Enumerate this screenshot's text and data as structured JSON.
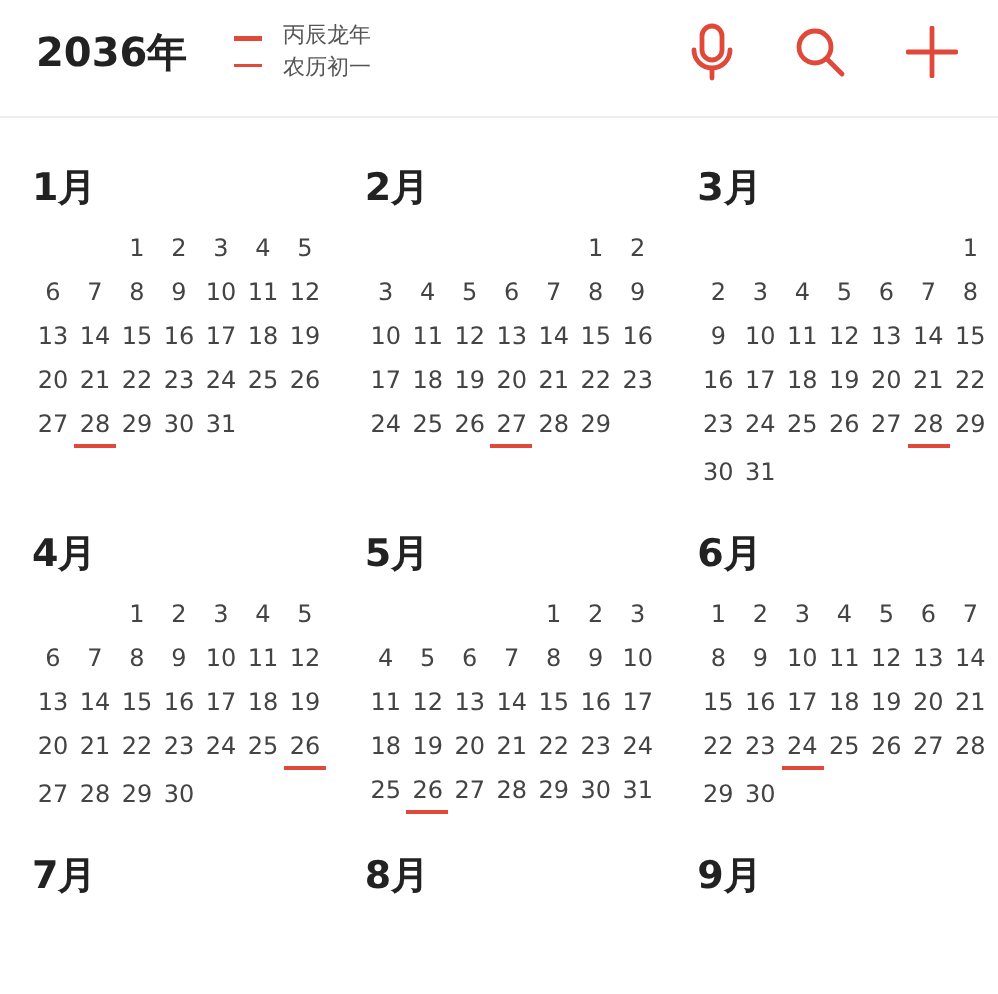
{
  "header": {
    "year": "2036年",
    "lunar_lines": [
      "丙辰龙年",
      "农历初一"
    ]
  },
  "months": [
    {
      "label": "1月",
      "weeks": [
        {
          "days": [
            {
              "day": "1",
              "underlined": false
            },
            {
              "day": "2",
              "underlined": false
            },
            {
              "day": "3",
              "underlined": false
            },
            {
              "day": "4",
              "underlined": false
            },
            {
              "day": "5",
              "underlined": false
            }
          ]
        },
        {
          "days": [
            {
              "day": "6",
              "underlined": false
            },
            {
              "day": "7",
              "underlined": false
            },
            {
              "day": "8",
              "underlined": false
            },
            {
              "day": "9",
              "underlined": false
            },
            {
              "day": "10",
              "underlined": false
            },
            {
              "day": "11",
              "underlined": false
            },
            {
              "day": "12",
              "underlined": false
            }
          ]
        },
        {
          "days": [
            {
              "day": "13",
              "underlined": false
            },
            {
              "day": "14",
              "underlined": false
            },
            {
              "day": "15",
              "underlined": false
            },
            {
              "day": "16",
              "underlined": false
            },
            {
              "day": "17",
              "underlined": false
            },
            {
              "day": "18",
              "underlined": false
            },
            {
              "day": "19",
              "underlined": false
            }
          ]
        },
        {
          "days": [
            {
              "day": "20",
              "underlined": false
            },
            {
              "day": "21",
              "underlined": false
            },
            {
              "day": "22",
              "underlined": false
            },
            {
              "day": "23",
              "underlined": false
            },
            {
              "day": "24",
              "underlined": false
            },
            {
              "day": "25",
              "underlined": false
            },
            {
              "day": "26",
              "underlined": false
            }
          ]
        },
        {
          "days": [
            {
              "day": "27",
              "underlined": false
            },
            {
              "day": "28",
              "underlined": true
            },
            {
              "day": "29",
              "underlined": false
            },
            {
              "day": "30",
              "underlined": false
            },
            {
              "day": "31",
              "underlined": false
            }
          ]
        }
      ]
    },
    {
      "label": "2月",
      "weeks": [
        {
          "days": [
            {
              "day": "1",
              "underlined": false
            },
            {
              "day": "2",
              "underlined": false
            }
          ]
        },
        {
          "days": [
            {
              "day": "3",
              "underlined": false
            },
            {
              "day": "4",
              "underlined": false
            },
            {
              "day": "5",
              "underlined": false
            },
            {
              "day": "6",
              "underlined": false
            },
            {
              "day": "7",
              "underlined": false
            },
            {
              "day": "8",
              "underlined": false
            },
            {
              "day": "9",
              "underlined": false
            }
          ]
        },
        {
          "days": [
            {
              "day": "10",
              "underlined": false
            },
            {
              "day": "11",
              "underlined": false
            },
            {
              "day": "12",
              "underlined": false
            },
            {
              "day": "13",
              "underlined": false
            },
            {
              "day": "14",
              "underlined": false
            },
            {
              "day": "15",
              "underlined": false
            },
            {
              "day": "16",
              "underlined": false
            }
          ]
        },
        {
          "days": [
            {
              "day": "17",
              "underlined": false
            },
            {
              "day": "18",
              "underlined": false
            },
            {
              "day": "19",
              "underlined": false
            },
            {
              "day": "20",
              "underlined": false
            },
            {
              "day": "21",
              "underlined": false
            },
            {
              "day": "22",
              "underlined": false
            },
            {
              "day": "23",
              "underlined": false
            }
          ]
        },
        {
          "days": [
            {
              "day": "24",
              "underlined": false
            },
            {
              "day": "25",
              "underlined": false
            },
            {
              "day": "26",
              "underlined": false
            },
            {
              "day": "27",
              "underlined": true
            },
            {
              "day": "28",
              "underlined": false
            },
            {
              "day": "29",
              "underlined": false
            }
          ]
        }
      ]
    },
    {
      "label": "3月",
      "weeks": [
        {
          "days": [
            {
              "day": "1",
              "underlined": false
            }
          ]
        },
        {
          "days": [
            {
              "day": "2",
              "underlined": false
            },
            {
              "day": "3",
              "underlined": false
            },
            {
              "day": "4",
              "underlined": false
            },
            {
              "day": "5",
              "underlined": false
            },
            {
              "day": "6",
              "underlined": false
            },
            {
              "day": "7",
              "underlined": false
            },
            {
              "day": "8",
              "underlined": false
            }
          ]
        },
        {
          "days": [
            {
              "day": "9",
              "underlined": false
            },
            {
              "day": "10",
              "underlined": false
            },
            {
              "day": "11",
              "underlined": false
            },
            {
              "day": "12",
              "underlined": false
            },
            {
              "day": "13",
              "underlined": false
            },
            {
              "day": "14",
              "underlined": false
            },
            {
              "day": "15",
              "underlined": false
            }
          ]
        },
        {
          "days": [
            {
              "day": "16",
              "underlined": false
            },
            {
              "day": "17",
              "underlined": false
            },
            {
              "day": "18",
              "underlined": false
            },
            {
              "day": "19",
              "underlined": false
            },
            {
              "day": "20",
              "underlined": false
            },
            {
              "day": "21",
              "underlined": false
            },
            {
              "day": "22",
              "underlined": false
            }
          ]
        },
        {
          "days": [
            {
              "day": "23",
              "underlined": false
            },
            {
              "day": "24",
              "underlined": false
            },
            {
              "day": "25",
              "underlined": false
            },
            {
              "day": "26",
              "underlined": false
            },
            {
              "day": "27",
              "underlined": false
            },
            {
              "day": "28",
              "underlined": true
            },
            {
              "day": "29",
              "underlined": false
            }
          ]
        },
        {
          "days": [
            {
              "day": "30",
              "underlined": false
            },
            {
              "day": "31",
              "underlined": false
            }
          ]
        }
      ]
    },
    {
      "label": "4月",
      "weeks": [
        {
          "days": [
            {
              "day": "1",
              "underlined": false
            },
            {
              "day": "2",
              "underlined": false
            },
            {
              "day": "3",
              "underlined": false
            },
            {
              "day": "4",
              "underlined": false
            },
            {
              "day": "5",
              "underlined": false
            }
          ]
        },
        {
          "days": [
            {
              "day": "6",
              "underlined": false
            },
            {
              "day": "7",
              "underlined": false
            },
            {
              "day": "8",
              "underlined": false
            },
            {
              "day": "9",
              "underlined": false
            },
            {
              "day": "10",
              "underlined": false
            },
            {
              "day": "11",
              "underlined": false
            },
            {
              "day": "12",
              "underlined": false
            }
          ]
        },
        {
          "days": [
            {
              "day": "13",
              "underlined": false
            },
            {
              "day": "14",
              "underlined": false
            },
            {
              "day": "15",
              "underlined": false
            },
            {
              "day": "16",
              "underlined": false
            },
            {
              "day": "17",
              "underlined": false
            },
            {
              "day": "18",
              "underlined": false
            },
            {
              "day": "19",
              "underlined": false
            }
          ]
        },
        {
          "days": [
            {
              "day": "20",
              "underlined": false
            },
            {
              "day": "21",
              "underlined": false
            },
            {
              "day": "22",
              "underlined": false
            },
            {
              "day": "23",
              "underlined": false
            },
            {
              "day": "24",
              "underlined": false
            },
            {
              "day": "25",
              "underlined": false
            },
            {
              "day": "26",
              "underlined": true
            }
          ]
        },
        {
          "days": [
            {
              "day": "27",
              "underlined": false
            },
            {
              "day": "28",
              "underlined": false
            },
            {
              "day": "29",
              "underlined": false
            },
            {
              "day": "30",
              "underlined": false
            }
          ]
        }
      ]
    },
    {
      "label": "5月",
      "weeks": [
        {
          "days": [
            {
              "day": "1",
              "underlined": false
            },
            {
              "day": "2",
              "underlined": false
            },
            {
              "day": "3",
              "underlined": false
            }
          ]
        },
        {
          "days": [
            {
              "day": "4",
              "underlined": false
            },
            {
              "day": "5",
              "underlined": false
            },
            {
              "day": "6",
              "underlined": false
            },
            {
              "day": "7",
              "underlined": false
            },
            {
              "day": "8",
              "underlined": false
            },
            {
              "day": "9",
              "underlined": false
            },
            {
              "day": "10",
              "underlined": false
            }
          ]
        },
        {
          "days": [
            {
              "day": "11",
              "underlined": false
            },
            {
              "day": "12",
              "underlined": false
            },
            {
              "day": "13",
              "underlined": false
            },
            {
              "day": "14",
              "underlined": false
            },
            {
              "day": "15",
              "underlined": false
            },
            {
              "day": "16",
              "underlined": false
            },
            {
              "day": "17",
              "underlined": false
            }
          ]
        },
        {
          "days": [
            {
              "day": "18",
              "underlined": false
            },
            {
              "day": "19",
              "underlined": false
            },
            {
              "day": "20",
              "underlined": false
            },
            {
              "day": "21",
              "underlined": false
            },
            {
              "day": "22",
              "underlined": false
            },
            {
              "day": "23",
              "underlined": false
            },
            {
              "day": "24",
              "underlined": false
            }
          ]
        },
        {
          "days": [
            {
              "day": "25",
              "underlined": false
            },
            {
              "day": "26",
              "underlined": true
            },
            {
              "day": "27",
              "underlined": false
            },
            {
              "day": "28",
              "underlined": false
            },
            {
              "day": "29",
              "underlined": false
            },
            {
              "day": "30",
              "underlined": false
            },
            {
              "day": "31",
              "underlined": false
            }
          ]
        }
      ]
    },
    {
      "label": "6月",
      "weeks": [
        {
          "days": [
            {
              "day": "1",
              "underlined": false
            },
            {
              "day": "2",
              "underlined": false
            },
            {
              "day": "3",
              "underlined": false
            },
            {
              "day": "4",
              "underlined": false
            },
            {
              "day": "5",
              "underlined": false
            },
            {
              "day": "6",
              "underlined": false
            },
            {
              "day": "7",
              "underlined": false
            }
          ]
        },
        {
          "days": [
            {
              "day": "8",
              "underlined": false
            },
            {
              "day": "9",
              "underlined": false
            },
            {
              "day": "10",
              "underlined": false
            },
            {
              "day": "11",
              "underlined": false
            },
            {
              "day": "12",
              "underlined": false
            },
            {
              "day": "13",
              "underlined": false
            },
            {
              "day": "14",
              "underlined": false
            }
          ]
        },
        {
          "days": [
            {
              "day": "15",
              "underlined": false
            },
            {
              "day": "16",
              "underlined": false
            },
            {
              "day": "17",
              "underlined": false
            },
            {
              "day": "18",
              "underlined": false
            },
            {
              "day": "19",
              "underlined": false
            },
            {
              "day": "20",
              "underlined": false
            },
            {
              "day": "21",
              "underlined": false
            }
          ]
        },
        {
          "days": [
            {
              "day": "22",
              "underlined": false
            },
            {
              "day": "23",
              "underlined": false
            },
            {
              "day": "24",
              "underlined": true
            },
            {
              "day": "25",
              "underlined": false
            },
            {
              "day": "26",
              "underlined": false
            },
            {
              "day": "27",
              "underlined": false
            },
            {
              "day": "28",
              "underlined": false
            }
          ]
        },
        {
          "days": [
            {
              "day": "29",
              "underlined": false
            },
            {
              "day": "30",
              "underlined": false
            }
          ]
        }
      ]
    },
    {
      "label": "7月"
    },
    {
      "label": "8月"
    },
    {
      "label": "9月"
    }
  ]
}
